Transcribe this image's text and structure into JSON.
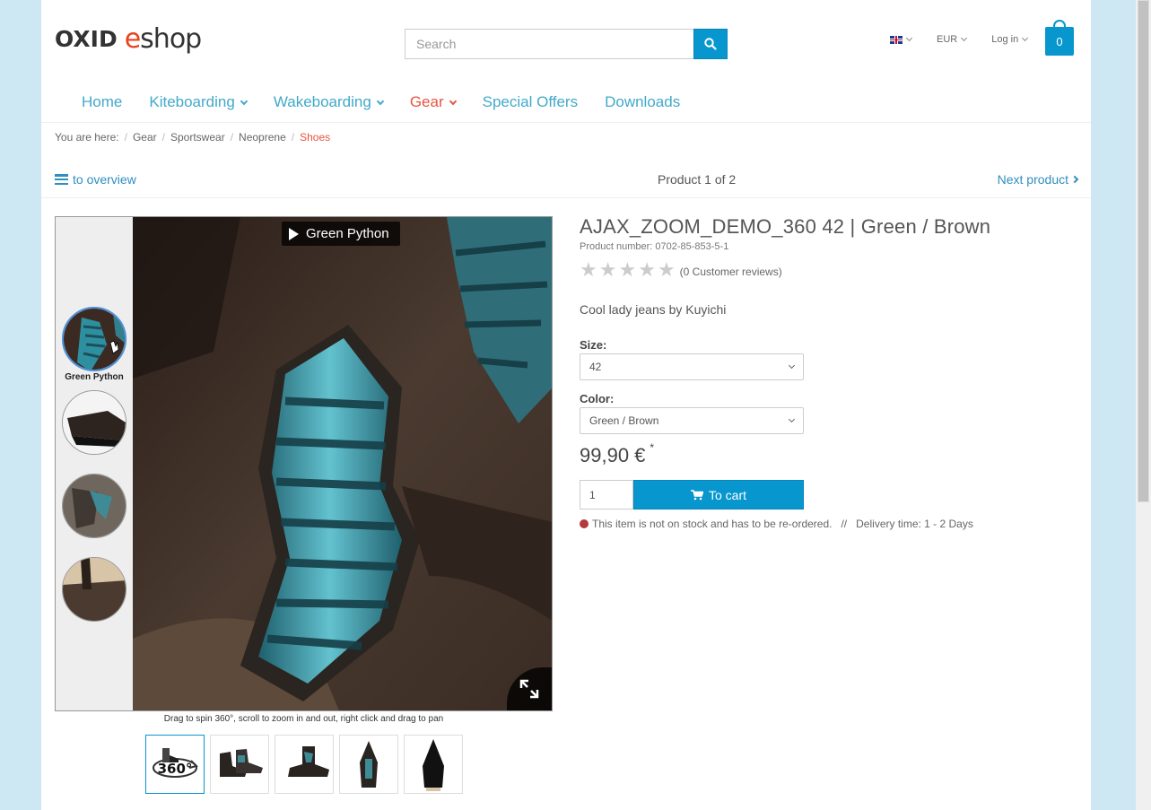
{
  "logo": {
    "part1": "OXID",
    "part2": "e",
    "part3": "shop"
  },
  "search": {
    "placeholder": "Search"
  },
  "topnav": {
    "currency": "EUR",
    "login": "Log in"
  },
  "cart": {
    "count": "0"
  },
  "mainnav": [
    {
      "label": "Home",
      "dropdown": false
    },
    {
      "label": "Kiteboarding",
      "dropdown": true
    },
    {
      "label": "Wakeboarding",
      "dropdown": true
    },
    {
      "label": "Gear",
      "dropdown": true,
      "active": true
    },
    {
      "label": "Special Offers",
      "dropdown": false
    },
    {
      "label": "Downloads",
      "dropdown": false
    }
  ],
  "breadcrumb": {
    "prefix": "You are here:",
    "items": [
      "Gear",
      "Sportswear",
      "Neoprene",
      "Shoes"
    ]
  },
  "productnav": {
    "overview": "to overview",
    "count": "Product 1 of 2",
    "next": "Next product"
  },
  "viewer": {
    "current_label": "Green Python",
    "thumb_label": "Green Python",
    "hint": "Drag to spin 360°, scroll to zoom in and out, right click and drag to pan",
    "thumb_360_label": "360°"
  },
  "product": {
    "title": "AJAX_ZOOM_DEMO_360 42 | Green / Brown",
    "number": "Product number: 0702-85-853-5-1",
    "rating": 0,
    "reviews": "(0 Customer reviews)",
    "short_desc": "Cool lady jeans by Kuyichi",
    "size_label": "Size:",
    "size_value": "42",
    "color_label": "Color:",
    "color_value": "Green / Brown",
    "price": "99,90 €",
    "price_note": "*",
    "qty": "1",
    "tocart": "To cart",
    "stock_text": "This item is not on stock and has to be re-ordered.",
    "stock_sep": "//",
    "delivery": "Delivery time: 1 - 2 Days"
  },
  "colors": {
    "accent": "#0796ce",
    "nav_link": "#42a9ca",
    "active": "#e8543e",
    "stock_dot": "#b43b3b"
  }
}
